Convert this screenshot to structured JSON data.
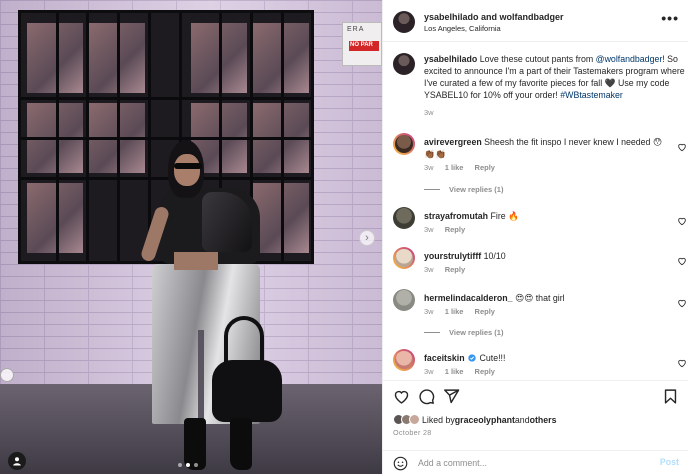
{
  "post_header": {
    "author_line": "ysabelhilado and wolfandbadger",
    "location": "Los Angeles, California",
    "more": "•••"
  },
  "photo": {
    "sign_top": "ERA",
    "sign_red": "NO PAR",
    "next_arrow": "›",
    "carousel_dots": 3,
    "active_dot": 2
  },
  "caption": {
    "username": "ysabelhilado",
    "text_1": " Love these cutout pants from ",
    "mention": "@wolfandbadger",
    "text_2": "! So excited to announce I'm a part of their Tastemakers program where I've curated a few of my favorite pieces for fall 🖤 Use my code YSABEL10 for 10% off your order! ",
    "hashtag": "#WBtastemaker",
    "time": "3w"
  },
  "comments": [
    {
      "username": "avirevergreen",
      "text": "Sheesh the fit inspo I never knew I needed 😯👏🏾👏🏾",
      "time": "3w",
      "likes": "1 like",
      "reply": "Reply",
      "view_replies": "View replies (1)"
    },
    {
      "username": "strayafromutah",
      "text": "Fire 🔥",
      "time": "3w",
      "likes": "",
      "reply": "Reply",
      "view_replies": ""
    },
    {
      "username": "yourstrulytifff",
      "text": "10/10",
      "time": "3w",
      "likes": "",
      "reply": "Reply",
      "view_replies": ""
    },
    {
      "username": "hermelindacalderon_",
      "text": "😍😍 that girl",
      "time": "3w",
      "likes": "1 like",
      "reply": "Reply",
      "view_replies": "View replies (1)"
    },
    {
      "username": "faceitskin",
      "text": "Cute!!!",
      "time": "3w",
      "likes": "1 like",
      "reply": "Reply",
      "view_replies": ""
    }
  ],
  "likes": {
    "prefix": "Liked by ",
    "user": "graceolyphant",
    "and": " and ",
    "others": "others"
  },
  "date": "October 28",
  "add_comment": {
    "placeholder": "Add a comment...",
    "post_label": "Post"
  },
  "colors": {
    "link": "#00376b",
    "secondary": "#8e8e8e",
    "post_disabled": "#b2dffc",
    "story_ring": "#c13584",
    "verified": "#3897f0"
  }
}
